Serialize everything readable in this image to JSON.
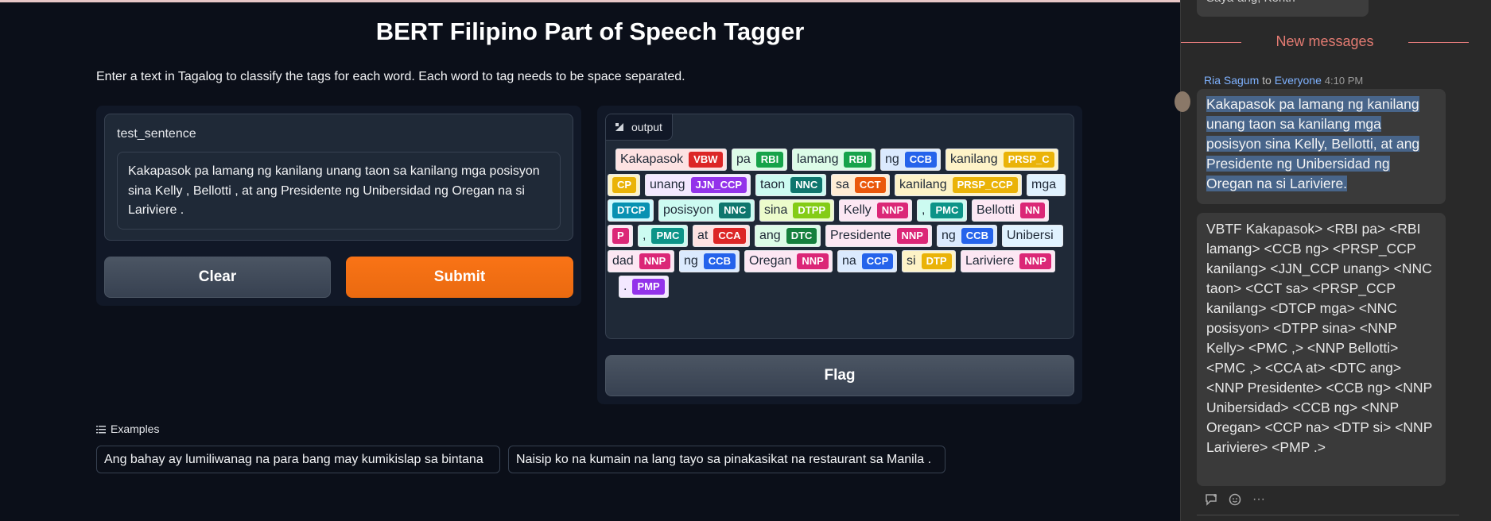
{
  "app": {
    "title": "BERT Filipino Part of Speech Tagger",
    "description": "Enter a text in Tagalog to classify the tags for each word. Each word to tag needs to be space separated."
  },
  "input": {
    "label": "test_sentence",
    "value": "Kakapasok pa lamang ng kanilang unang taon sa kanilang mga posisyon sina Kelly , Bellotti , at ang Presidente ng Unibersidad ng Oregan na si Lariviere ."
  },
  "buttons": {
    "clear": "Clear",
    "submit": "Submit",
    "flag": "Flag"
  },
  "output": {
    "label": "output",
    "rows": [
      [
        [
          "Kakapasok",
          "VBW"
        ],
        [
          "pa",
          "RBI"
        ],
        [
          "lamang",
          "RBI"
        ],
        [
          "ng",
          "CCB"
        ],
        [
          "kanilang",
          "PRSP_C"
        ]
      ],
      [
        [
          "",
          "CP"
        ],
        [
          "unang",
          "JJN_CCP"
        ],
        [
          "taon",
          "NNC"
        ],
        [
          "sa",
          "CCT"
        ],
        [
          "kanilang",
          "PRSP_CCP"
        ],
        [
          "mga",
          ""
        ]
      ],
      [
        [
          "",
          "DTCP"
        ],
        [
          "posisyon",
          "NNC"
        ],
        [
          "sina",
          "DTPP"
        ],
        [
          "Kelly",
          "NNP"
        ],
        [
          ",",
          "PMC"
        ],
        [
          "Bellotti",
          "NN"
        ]
      ],
      [
        [
          "",
          "P"
        ],
        [
          ",",
          "PMC"
        ],
        [
          "at",
          "CCA"
        ],
        [
          "ang",
          "DTC"
        ],
        [
          "Presidente",
          "NNP"
        ],
        [
          "ng",
          "CCB"
        ],
        [
          "Unibersi",
          ""
        ]
      ],
      [
        [
          "dad",
          "NNP"
        ],
        [
          "ng",
          "CCB"
        ],
        [
          "Oregan",
          "NNP"
        ],
        [
          "na",
          "CCP"
        ],
        [
          "si",
          "DTP"
        ],
        [
          "Lariviere",
          "NNP"
        ]
      ],
      [
        [
          ".",
          "PMP"
        ]
      ]
    ],
    "colors": {
      "VBW": "#dc2626",
      "RBI": "#16a34a",
      "CCB": "#2563eb",
      "PRSP": "#eab308",
      "JJN": "#9333ea",
      "NNC": "#0f766e",
      "CCT": "#ea580c",
      "DTCP": "#0891b2",
      "DTPP": "#84cc16",
      "NNP": "#db2777",
      "PMC": "#0d9488",
      "CCA": "#dc2626",
      "DTC": "#15803d",
      "CCP": "#2563eb",
      "DTP": "#eab308",
      "PMP": "#9333ea"
    }
  },
  "examples": {
    "label": "Examples",
    "items": [
      "Ang bahay ay lumiliwanag na para bang may kumikislap sa bintana",
      "Naisip ko na kumain na lang tayo sa pinakasikat na restaurant sa Manila ."
    ]
  },
  "chat": {
    "previous_message": "Saya-ang, Kenth",
    "new_messages_label": "New messages",
    "sender": "Ria Sagum",
    "to_word": "to",
    "recipient": "Everyone",
    "time": "4:10 PM",
    "message1": "Kakapasok pa lamang ng kanilang unang taon sa kanilang mga posisyon sina Kelly, Bellotti, at ang Presidente ng Unibersidad ng Oregan na si Lariviere.",
    "message2": "VBTF Kakapasok> <RBI pa> <RBI lamang> <CCB ng> <PRSP_CCP kanilang> <JJN_CCP unang> <NNC taon> <CCT sa> <PRSP_CCP kanilang> <DTCP mga> <NNC posisyon> <DTPP sina> <NNP Kelly> <PMC ,> <NNP Bellotti> <PMC ,> <CCA at> <DTC ang> <NNP Presidente> <CCB ng> <NNP Unibersidad> <CCB ng> <NNP Oregan> <CCP na> <DTP si> <NNP Lariviere> <PMP .>",
    "more": "···"
  }
}
